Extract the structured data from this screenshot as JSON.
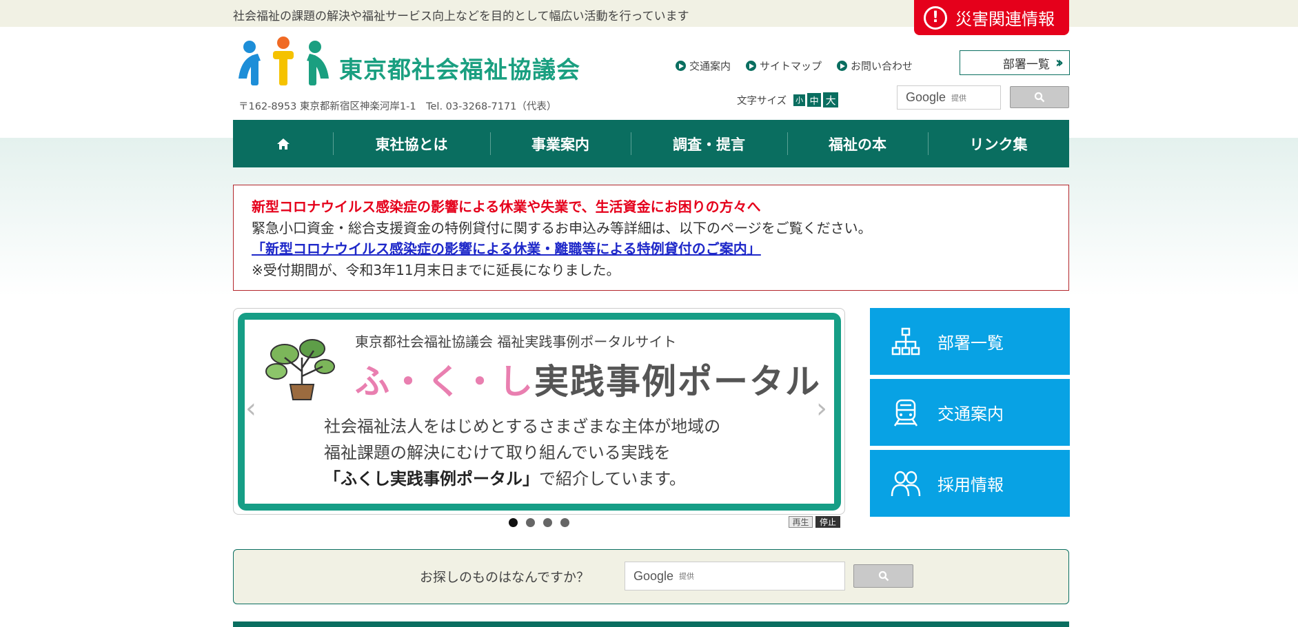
{
  "header": {
    "tagline": "社会福祉の課題の解決や福祉サービス向上などを目的として幅広い活動を行っています",
    "disaster_label": "災害関連情報",
    "org_name": "東京都社会福祉協議会",
    "address": "〒162-8953 東京都新宿区神楽河岸1-1　Tel. 03-3268-7171（代表）",
    "util_links": [
      "交通案内",
      "サイトマップ",
      "お問い合わせ"
    ],
    "dept_button": "部署一覧",
    "font_size_label": "文字サイズ",
    "font_sizes": [
      "小",
      "中",
      "大"
    ],
    "search_brand": "Google",
    "search_provided": "提供"
  },
  "nav": {
    "items": [
      "東社協とは",
      "事業案内",
      "調査・提言",
      "福祉の本",
      "リンク集"
    ]
  },
  "notice": {
    "heading": "新型コロナウイルス感染症の影響による休業や失業で、生活資金にお困りの方々へ",
    "body": "緊急小口資金・総合支援資金の特例貸付に関するお申込み等詳細は、以下のページをご覧ください。",
    "link": "「新型コロナウイルス感染症の影響による休業・離職等による特例貸付のご案内」",
    "note": "※受付期間が、令和3年11月末日までに延長になりました。"
  },
  "carousel": {
    "subtitle": "東京都社会福祉協議会 福祉実践事例ポータルサイト",
    "title_kana": "ふ・く・し",
    "title_rest": "実践事例ポータル",
    "line1": "社会福祉法人をはじめとするさまざまな主体が地域の",
    "line2": "福祉課題の解決にむけて取り組んでいる実践を",
    "line3_bold": "「ふくし実践事例ポータル」",
    "line3_rest": "で紹介しています。",
    "play": "再生",
    "stop": "停止",
    "slides_count": 4,
    "active_slide": 1
  },
  "side_menu": [
    "部署一覧",
    "交通案内",
    "採用情報"
  ],
  "bottom_search": {
    "question": "お探しのものはなんですか？",
    "brand": "Google",
    "provided": "提供"
  },
  "colors": {
    "brand_green": "#0a6e60",
    "alert_red": "#e5001b",
    "side_blue": "#08a2e4"
  }
}
